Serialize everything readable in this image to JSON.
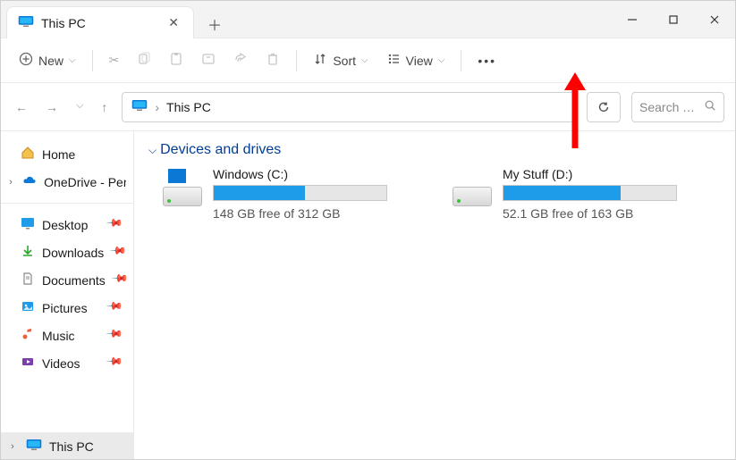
{
  "window": {
    "tab_title": "This PC"
  },
  "toolbar": {
    "new": "New",
    "sort": "Sort",
    "view": "View"
  },
  "nav": {
    "breadcrumb": "This PC",
    "search_placeholder": "Search This PC"
  },
  "sidebar": {
    "home": "Home",
    "onedrive": "OneDrive - Personal",
    "desktop": "Desktop",
    "downloads": "Downloads",
    "documents": "Documents",
    "pictures": "Pictures",
    "music": "Music",
    "videos": "Videos",
    "thispc": "This PC"
  },
  "section": {
    "title": "Devices and drives"
  },
  "drives": [
    {
      "name": "Windows (C:)",
      "free_text": "148 GB free of 312 GB",
      "fill_percent": 53
    },
    {
      "name": "My Stuff (D:)",
      "free_text": "52.1 GB free of 163 GB",
      "fill_percent": 68
    }
  ]
}
